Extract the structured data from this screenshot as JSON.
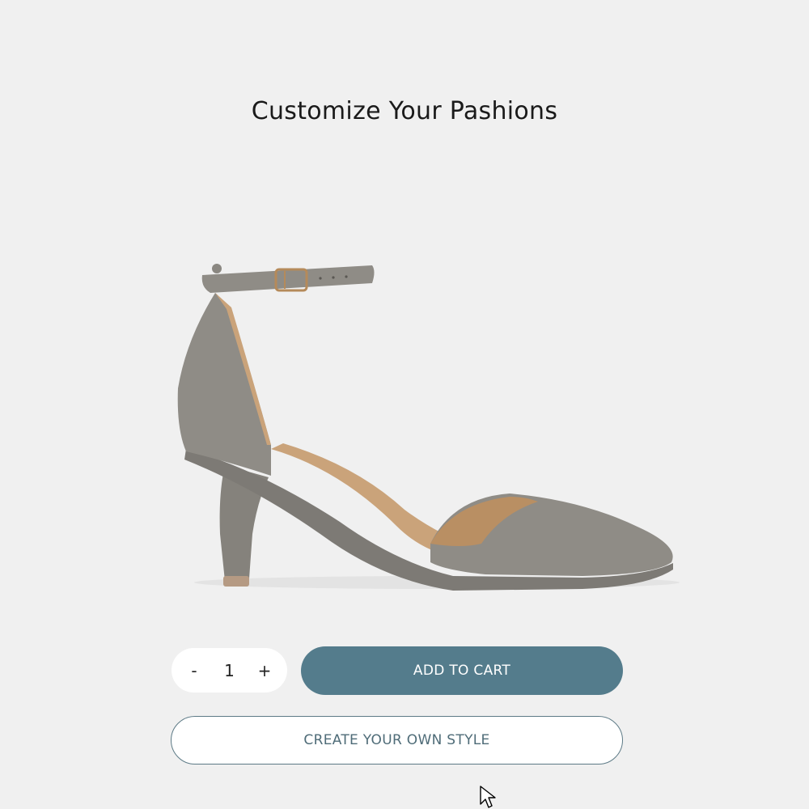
{
  "header": {
    "title": "Customize Your Pashions"
  },
  "product": {
    "image_icon": "high-heel-shoe",
    "colors": {
      "suede": "#8f8c86",
      "lining": "#caa37a",
      "buckle": "#b58a5a"
    }
  },
  "purchase": {
    "quantity": {
      "decrement_label": "-",
      "value": "1",
      "increment_label": "+"
    },
    "add_to_cart_label": "ADD TO CART",
    "create_style_label": "CREATE YOUR OWN STYLE"
  },
  "colors": {
    "background": "#f0f0f0",
    "primary_button": "#547c8c",
    "outline_button_border": "#5d7a86"
  }
}
